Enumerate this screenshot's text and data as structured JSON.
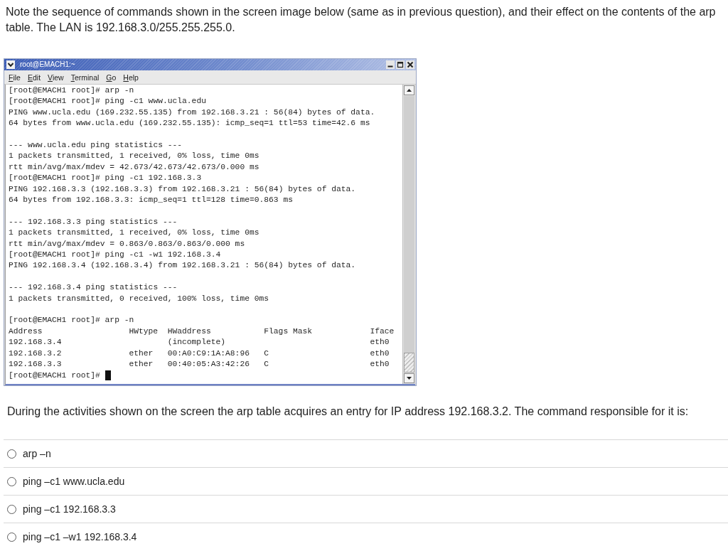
{
  "intro": "Note the sequence of commands shown in the screen image below (same as in previous question), and their effect on the contents of the arp table. The LAN is 192.168.3.0/255.255.255.0.",
  "terminal": {
    "title": "root@EMACH1:~",
    "menu": [
      "File",
      "Edit",
      "View",
      "Terminal",
      "Go",
      "Help"
    ],
    "blocks": [
      [
        "[root@EMACH1 root]# arp -n",
        "[root@EMACH1 root]# ping -c1 www.ucla.edu",
        "PING www.ucla.edu (169.232.55.135) from 192.168.3.21 : 56(84) bytes of data.",
        "64 bytes from www.ucla.edu (169.232.55.135): icmp_seq=1 ttl=53 time=42.6 ms"
      ],
      [
        "--- www.ucla.edu ping statistics ---",
        "1 packets transmitted, 1 received, 0% loss, time 0ms",
        "rtt min/avg/max/mdev = 42.673/42.673/42.673/0.000 ms",
        "[root@EMACH1 root]# ping -c1 192.168.3.3",
        "PING 192.168.3.3 (192.168.3.3) from 192.168.3.21 : 56(84) bytes of data.",
        "64 bytes from 192.168.3.3: icmp_seq=1 ttl=128 time=0.863 ms"
      ],
      [
        "--- 192.168.3.3 ping statistics ---",
        "1 packets transmitted, 1 received, 0% loss, time 0ms",
        "rtt min/avg/max/mdev = 0.863/0.863/0.863/0.000 ms",
        "[root@EMACH1 root]# ping -c1 -w1 192.168.3.4",
        "PING 192.168.3.4 (192.168.3.4) from 192.168.3.21 : 56(84) bytes of data."
      ],
      [
        "--- 192.168.3.4 ping statistics ---",
        "1 packets transmitted, 0 received, 100% loss, time 0ms"
      ],
      [
        "[root@EMACH1 root]# arp -n"
      ]
    ],
    "arp_table": {
      "columns": [
        "Address",
        "HWtype",
        "HWaddress",
        "Flags Mask",
        "Iface"
      ],
      "rows": [
        [
          "192.168.3.4",
          null,
          "(incomplete)",
          null,
          "eth0"
        ],
        [
          "192.168.3.2",
          "ether",
          "00:A0:C9:1A:A8:96",
          "C",
          "eth0"
        ],
        [
          "192.168.3.3",
          "ether",
          "00:40:05:A3:42:26",
          "C",
          "eth0"
        ]
      ]
    },
    "prompt": "[root@EMACH1 root]#"
  },
  "question": {
    "text": "During the activities shown on the screen the arp table acquires an entry for IP address 192.168.3.2. The command responsible for it is:",
    "options": [
      {
        "label": "arp –n",
        "selected": false
      },
      {
        "label": "ping –c1 www.ucla.edu",
        "selected": false
      },
      {
        "label": "ping –c1 192.168.3.3",
        "selected": false
      },
      {
        "label": "ping –c1 –w1 192.168.3.4",
        "selected": false
      }
    ]
  }
}
